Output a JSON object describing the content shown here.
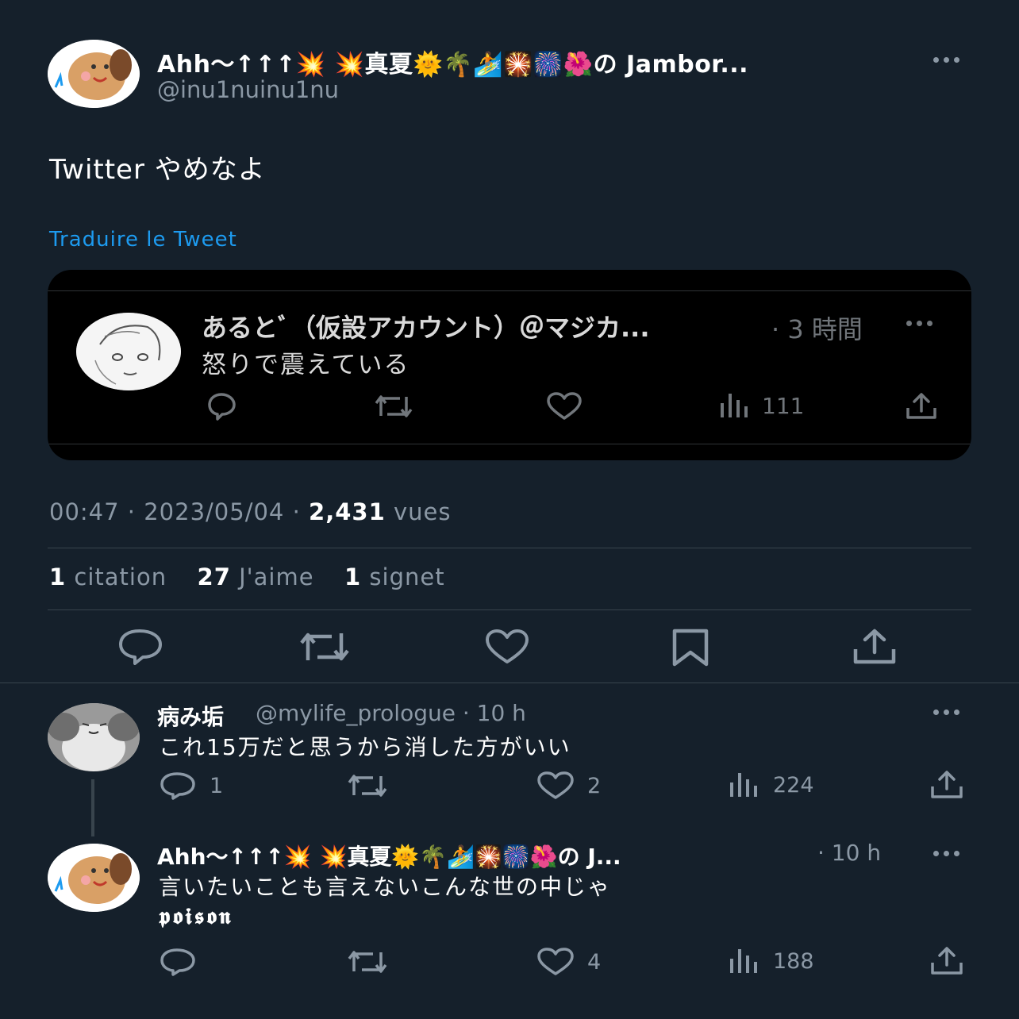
{
  "main_tweet": {
    "display_name": "Ahh〜↑↑↑💥 💥真夏🌞🌴🏄🎇🎆🌺の Jambor...",
    "handle": "@inu1nuinu1nu",
    "text": "Twitter やめなよ",
    "translate_label": "Traduire le Tweet",
    "time": "00:47",
    "date": "2023/05/04",
    "views_count": "2,431",
    "views_label": "vues",
    "quotes_count": "1",
    "quotes_label": "citation",
    "likes_count": "27",
    "likes_label": "J'aime",
    "bookmarks_count": "1",
    "bookmarks_label": "signet"
  },
  "quoted_tweet": {
    "display_name": "あるとﾞ（仮設アカウント）＠マジカ...",
    "time": "· 3 時間",
    "text": "怒りで震えている",
    "views_count": "111"
  },
  "replies": [
    {
      "display_name": "病み垢",
      "meta": "@mylife_prologue · 10 h",
      "text": "これ15万だと思うから消した方がいい",
      "text_line2": "",
      "reply_count": "1",
      "retweet_count": "",
      "like_count": "2",
      "views_count": "224"
    },
    {
      "display_name": "Ahh〜↑↑↑💥 💥真夏🌞🌴🏄🎇🎆🌺の J...",
      "meta": "· 10 h",
      "text": "言いたいことも言えないこんな世の中じゃ",
      "text_line2": "𝖕𝖔𝖎𝖘𝖔𝖓",
      "reply_count": "",
      "retweet_count": "",
      "like_count": "4",
      "views_count": "188"
    }
  ],
  "colors": {
    "background": "#15202b",
    "accent_link": "#1d9bf0",
    "muted_text": "#8b98a5",
    "divider": "#38444d",
    "quote_card_bg": "#000000"
  },
  "icons": [
    "reply-icon",
    "retweet-icon",
    "like-icon",
    "views-icon",
    "share-icon",
    "bookmark-icon",
    "more-icon"
  ]
}
